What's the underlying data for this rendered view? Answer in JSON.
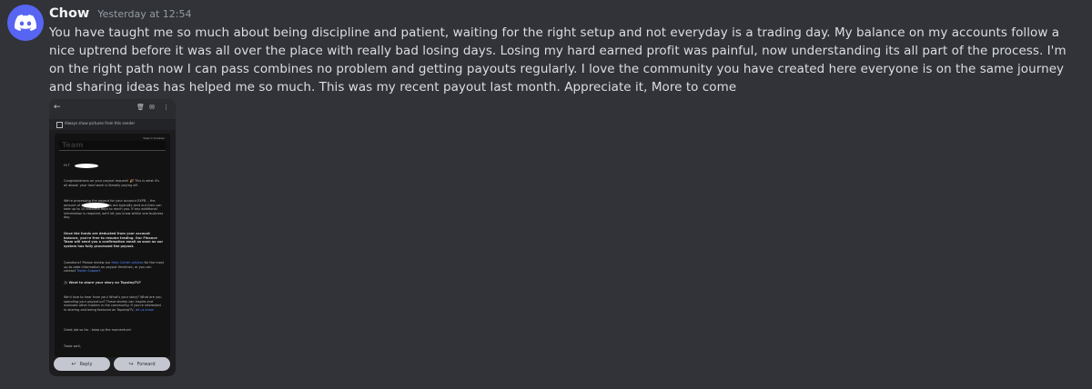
{
  "message": {
    "author": "Chow",
    "timestamp": "Yesterday at 12:54",
    "text": "You have taught me so much about being discipline and patient, waiting for the right setup and not everyday is a trading day. My balance on my accounts follow a nice uptrend before it was all over the place with really bad losing days. Losing my hard earned profit was painful, now understanding its all part of the process. I'm on the right path now I can pass combines no problem and getting payouts regularly. I love the community you have created here everyone is on the same journey and sharing ideas has helped me so much. This was my recent payout last month. Appreciate it, More to come",
    "avatar_icon": "discord-logo-icon",
    "avatar_color": "#5865f2"
  },
  "attachment": {
    "topbar_icons": [
      "back-arrow-icon",
      "trash-icon",
      "mail-icon",
      "more-icon"
    ],
    "images_notice": "Always show pictures from this sender",
    "email": {
      "header_link": "View in browser",
      "logo": "Team",
      "greeting": "Hi T",
      "p1": "Congratulations on your payout request! 🎉 This is what it's all about: your hard work is literally paying off.",
      "p2": "We're processing the payout for your account EXPR… the amount of $ 1451.36. Payouts are typically sent out then can take up to 10 business days to reach you. If any additional information is required, we'll let you know within one business day.",
      "p3": "Once the funds are deducted from your account balance, you're free to resume trading. Our Finance Team will send you a confirmation email as soon as our system has fully processed the payout.",
      "p4_a": "Questions? Please review our ",
      "p4_link": "Help Center articles",
      "p4_b": " for the most up-to-date information on payout timelines, or you can contact ",
      "p4_link2": "Trader Support",
      "p5": "🎥 Want to share your story on TopstepTV?",
      "p6_a": "We'd love to hear from you! What's your story? What are you spending your payout on? These stories can inspire and motivate other traders in the community. If you're interested in sharing and being featured on TopstepTV, ",
      "p6_link": "let us know",
      "p7": "Great job so far - keep up the momentum!",
      "p8": "Trade well,"
    },
    "reply_label": "Reply",
    "forward_label": "Forward"
  }
}
